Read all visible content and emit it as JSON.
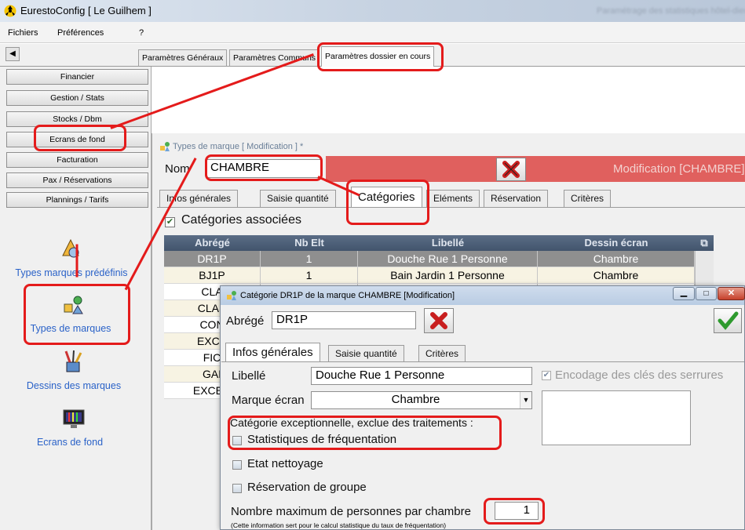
{
  "app": {
    "title": "EurestoConfig [ Le Guilhem ]",
    "title_right": "Paramétrage des statistiques hôtel-dieu"
  },
  "menu": [
    "Fichiers",
    "Préférences",
    "?"
  ],
  "top_tabs": [
    "Paramètres Généraux",
    "Paramètres Communs",
    "Paramètres dossier en cours"
  ],
  "sidebar": {
    "buttons": [
      "Financier",
      "Gestion / Stats",
      "Stocks / Dbm",
      "Ecrans de fond",
      "Facturation",
      "Pax / Réservations",
      "Plannings / Tarifs"
    ],
    "icons": [
      "Types marques prédéfinis",
      "Types de marques",
      "Dessins des marques",
      "Ecrans de fond"
    ]
  },
  "win1": {
    "title": "Types de marque [ Modification ] *",
    "nom_label": "Nom",
    "nom_value": "CHAMBRE",
    "status": "Modification [CHAMBRE]",
    "tabs": [
      "Infos générales",
      "Saisie quantité",
      "Catégories",
      "Eléments",
      "Réservation",
      "Critères"
    ],
    "checkbox_label": "Catégories associées",
    "grid": {
      "columns": [
        "Abrégé",
        "Nb Elt",
        "Libellé",
        "Dessin écran"
      ],
      "rows": [
        [
          "DR1P",
          "1",
          "Douche Rue 1 Personne",
          "Chambre"
        ],
        [
          "BJ1P",
          "1",
          "Bain Jardin 1 Personne",
          "Chambre"
        ],
        [
          "CLA",
          "",
          "",
          ""
        ],
        [
          "CLAS",
          "",
          "",
          ""
        ],
        [
          "CON",
          "",
          "",
          ""
        ],
        [
          "EXCE",
          "",
          "",
          ""
        ],
        [
          "FIC",
          "",
          "",
          ""
        ],
        [
          "GAI",
          "",
          "",
          ""
        ],
        [
          "EXCEC",
          "",
          "",
          ""
        ]
      ]
    }
  },
  "dialog": {
    "title": "Catégorie DR1P de la marque CHAMBRE [Modification]",
    "abrege_label": "Abrégé",
    "abrege_value": "DR1P",
    "tabs": [
      "Infos générales",
      "Saisie quantité",
      "Critères"
    ],
    "libelle_label": "Libellé",
    "libelle_value": "Douche Rue 1 Personne",
    "encodage_label": "Encodage des clés des serrures",
    "marque_label": "Marque écran",
    "marque_value": "Chambre",
    "exception_label": "Catégorie exceptionnelle, exclue des traitements :",
    "stats_label": "Statistiques de fréquentation",
    "etat_label": "Etat nettoyage",
    "reservation_label": "Réservation de groupe",
    "max_label": "Nombre maximum de personnes par chambre",
    "max_value": "1",
    "note": "(Cette information sert pour le calcul statistique du taux de fréquentation)"
  },
  "colors": {
    "accent_red": "#e41b1b",
    "status_bar": "#e0605e",
    "grid_header": "#4c5d76",
    "selected_row": "#8f8f8f"
  }
}
